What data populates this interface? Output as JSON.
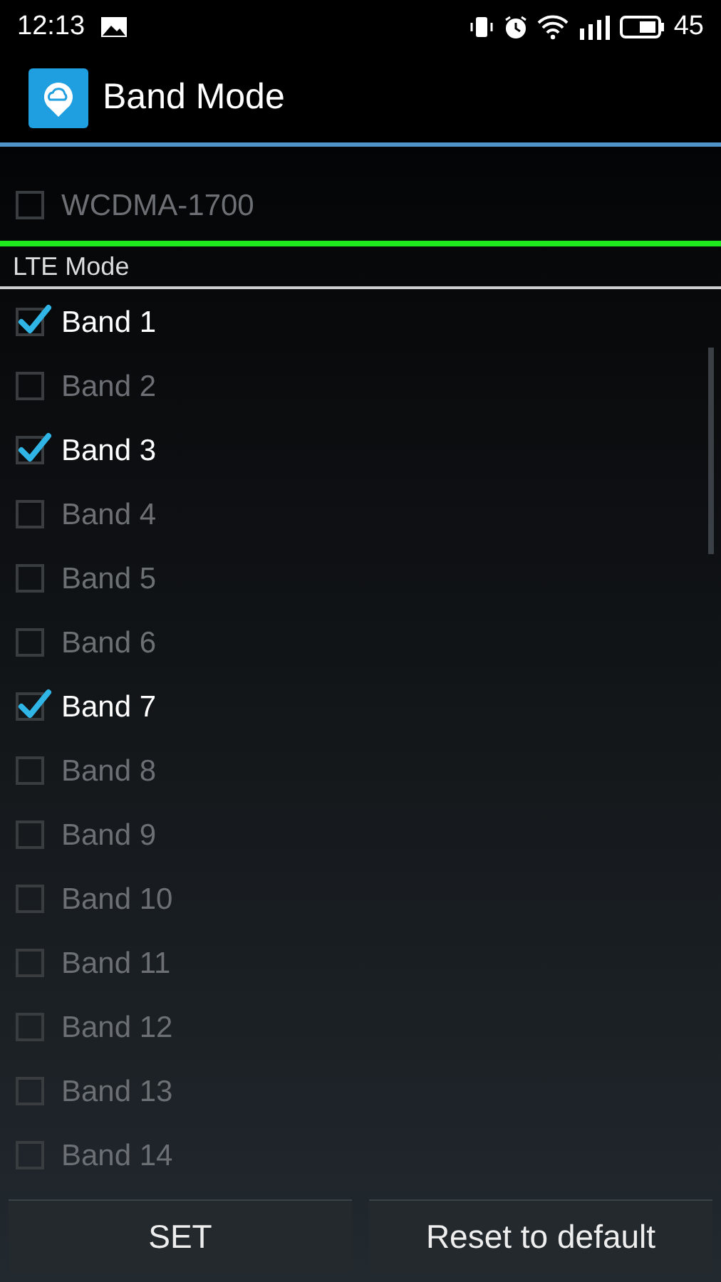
{
  "status_bar": {
    "time": "12:13",
    "battery": "45"
  },
  "app_bar": {
    "title": "Band Mode"
  },
  "wcdma_items": [
    {
      "label": "WCDMA-1700",
      "checked": false
    }
  ],
  "lte": {
    "heading": "LTE Mode",
    "bands": [
      {
        "label": "Band 1",
        "checked": true
      },
      {
        "label": "Band 2",
        "checked": false
      },
      {
        "label": "Band 3",
        "checked": true
      },
      {
        "label": "Band 4",
        "checked": false
      },
      {
        "label": "Band 5",
        "checked": false
      },
      {
        "label": "Band 6",
        "checked": false
      },
      {
        "label": "Band 7",
        "checked": true
      },
      {
        "label": "Band 8",
        "checked": false
      },
      {
        "label": "Band 9",
        "checked": false
      },
      {
        "label": "Band 10",
        "checked": false
      },
      {
        "label": "Band 11",
        "checked": false
      },
      {
        "label": "Band 12",
        "checked": false
      },
      {
        "label": "Band 13",
        "checked": false
      },
      {
        "label": "Band 14",
        "checked": false
      }
    ]
  },
  "buttons": [
    "SET",
    "Reset to default"
  ]
}
